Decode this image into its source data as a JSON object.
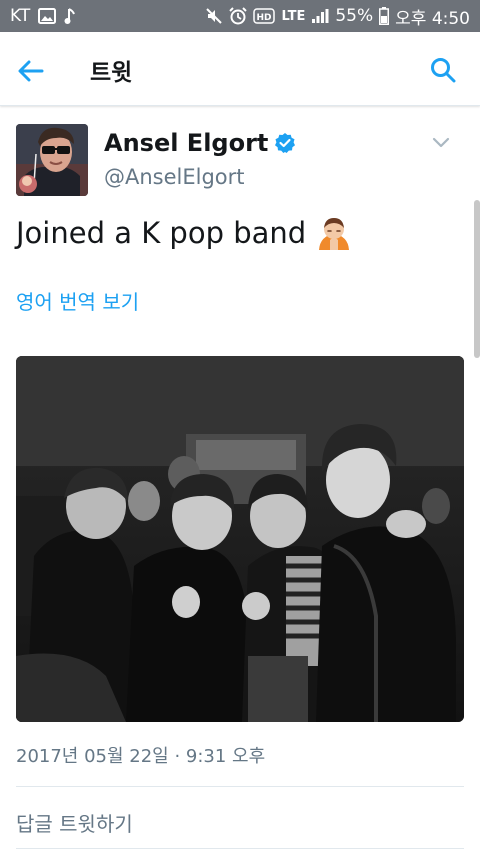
{
  "status_bar": {
    "carrier": "KT",
    "network": "LTE",
    "battery": "55%",
    "time": "오후 4:50",
    "icons": [
      "gallery-icon",
      "music-note-icon",
      "mute-icon",
      "alarm-icon",
      "hd-icon",
      "signal-icon",
      "battery-icon"
    ]
  },
  "header": {
    "title": "트윗",
    "back_icon": "back-arrow-icon",
    "search_icon": "search-icon",
    "accent_color": "#1da1f2"
  },
  "tweet": {
    "display_name": "Ansel Elgort",
    "verified": true,
    "handle": "@AnselElgort",
    "text": "Joined a K pop band",
    "emoji_icon": "person-bowing-icon",
    "translate_label": "영어 번역 보기",
    "timestamp": "2017년 05월 22일 · 9:31 오후"
  },
  "actions": {
    "reply_label": "답글 트윗하기"
  }
}
